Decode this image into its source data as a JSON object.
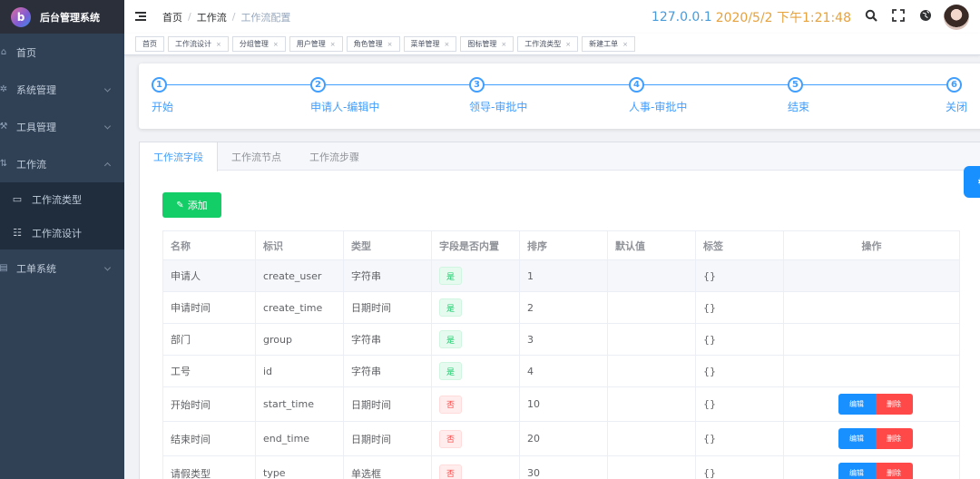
{
  "app": {
    "logo_letter": "b",
    "title": "后台管理系统"
  },
  "sidebar": {
    "items": [
      {
        "icon": "home-icon",
        "glyph": "⌂",
        "label": "首页",
        "chevron": ""
      },
      {
        "icon": "gear-icon",
        "glyph": "✲",
        "label": "系统管理",
        "chevron": "down"
      },
      {
        "icon": "tools-icon",
        "glyph": "⚒",
        "label": "工具管理",
        "chevron": "down"
      },
      {
        "icon": "workflow-icon",
        "glyph": "⇅",
        "label": "工作流",
        "chevron": "up"
      }
    ],
    "submenu": [
      {
        "icon": "box-icon",
        "glyph": "▭",
        "label": "工作流类型"
      },
      {
        "icon": "list-icon",
        "glyph": "☷",
        "label": "工作流设计"
      }
    ],
    "last_item": {
      "icon": "ticket-icon",
      "glyph": "▤",
      "label": "工单系统",
      "chevron": "down"
    }
  },
  "header": {
    "breadcrumb": [
      "首页",
      "工作流",
      "工作流配置"
    ],
    "separator": "/",
    "ip": "127.0.0.1",
    "datetime": "2020/5/2 下午1:21:48",
    "icons": [
      "search-icon",
      "fullscreen-icon",
      "globe-icon"
    ]
  },
  "tags": [
    {
      "label": "首页",
      "closable": false
    },
    {
      "label": "工作流设计",
      "closable": true
    },
    {
      "label": "分组管理",
      "closable": true
    },
    {
      "label": "用户管理",
      "closable": true
    },
    {
      "label": "角色管理",
      "closable": true
    },
    {
      "label": "菜单管理",
      "closable": true
    },
    {
      "label": "图标管理",
      "closable": true
    },
    {
      "label": "工作流类型",
      "closable": true
    },
    {
      "label": "新建工单",
      "closable": true
    }
  ],
  "steps": [
    {
      "num": "1",
      "label": "开始"
    },
    {
      "num": "2",
      "label": "申请人-编辑中"
    },
    {
      "num": "3",
      "label": "领导-审批中"
    },
    {
      "num": "4",
      "label": "人事-审批中"
    },
    {
      "num": "5",
      "label": "结束"
    },
    {
      "num": "6",
      "label": "关闭"
    }
  ],
  "tabs": [
    {
      "label": "工作流字段",
      "active": true
    },
    {
      "label": "工作流节点",
      "active": false
    },
    {
      "label": "工作流步骤",
      "active": false
    }
  ],
  "add_button": "添加",
  "table": {
    "headers": [
      "名称",
      "标识",
      "类型",
      "字段是否内置",
      "排序",
      "默认值",
      "标签",
      "操作"
    ],
    "rows": [
      {
        "name": "申请人",
        "key": "create_user",
        "type": "字符串",
        "builtin": "是",
        "builtin_yes": true,
        "order": "1",
        "default": "",
        "tag": "{}",
        "ops": false
      },
      {
        "name": "申请时间",
        "key": "create_time",
        "type": "日期时间",
        "builtin": "是",
        "builtin_yes": true,
        "order": "2",
        "default": "",
        "tag": "{}",
        "ops": false
      },
      {
        "name": "部门",
        "key": "group",
        "type": "字符串",
        "builtin": "是",
        "builtin_yes": true,
        "order": "3",
        "default": "",
        "tag": "{}",
        "ops": false
      },
      {
        "name": "工号",
        "key": "id",
        "type": "字符串",
        "builtin": "是",
        "builtin_yes": true,
        "order": "4",
        "default": "",
        "tag": "{}",
        "ops": false
      },
      {
        "name": "开始时间",
        "key": "start_time",
        "type": "日期时间",
        "builtin": "否",
        "builtin_yes": false,
        "order": "10",
        "default": "",
        "tag": "{}",
        "ops": true
      },
      {
        "name": "结束时间",
        "key": "end_time",
        "type": "日期时间",
        "builtin": "否",
        "builtin_yes": false,
        "order": "20",
        "default": "",
        "tag": "{}",
        "ops": true
      },
      {
        "name": "请假类型",
        "key": "type",
        "type": "单选框",
        "builtin": "否",
        "builtin_yes": false,
        "order": "30",
        "default": "",
        "tag": "{}",
        "ops": true
      }
    ],
    "edit_label": "编辑",
    "delete_label": "删除"
  },
  "colors": {
    "primary": "#409eff",
    "success": "#13ce66",
    "danger": "#ff4949",
    "sidebar": "#304156",
    "ip": "#4a9ad8",
    "datetime": "#e6a23c"
  }
}
